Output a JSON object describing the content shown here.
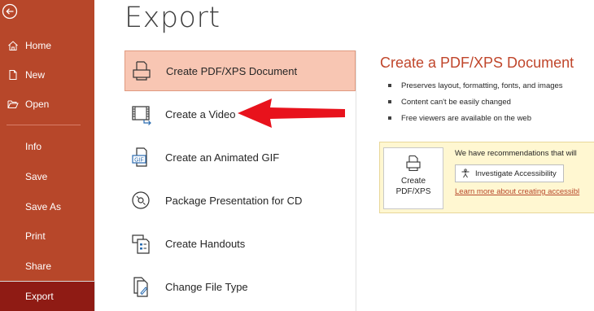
{
  "sidebar": {
    "items": [
      {
        "label": "Home",
        "icon": "home-icon"
      },
      {
        "label": "New",
        "icon": "new-document-icon"
      },
      {
        "label": "Open",
        "icon": "folder-open-icon"
      },
      {
        "label": "Info"
      },
      {
        "label": "Save"
      },
      {
        "label": "Save As"
      },
      {
        "label": "Print"
      },
      {
        "label": "Share"
      },
      {
        "label": "Export",
        "active": true
      }
    ]
  },
  "main": {
    "title": "Export",
    "options": [
      {
        "label": "Create PDF/XPS Document",
        "icon": "pdf-document-icon",
        "selected": true
      },
      {
        "label": "Create a Video",
        "icon": "video-icon"
      },
      {
        "label": "Create an Animated GIF",
        "icon": "gif-icon"
      },
      {
        "label": "Package Presentation for CD",
        "icon": "cd-icon"
      },
      {
        "label": "Create Handouts",
        "icon": "handouts-icon"
      },
      {
        "label": "Change File Type",
        "icon": "change-file-type-icon"
      }
    ]
  },
  "detail": {
    "title": "Create a PDF/XPS Document",
    "bullets": [
      "Preserves layout, formatting, fonts, and images",
      "Content can't be easily changed",
      "Free viewers are available on the web"
    ],
    "recommendation_text": "We have recommendations that will",
    "investigate_label": "Investigate Accessibility",
    "learn_more_label": "Learn more about creating accessibl",
    "create_button_line1": "Create",
    "create_button_line2": "PDF/XPS"
  },
  "colors": {
    "sidebar_bg": "#b7472a",
    "sidebar_active": "#8f1b14",
    "selected_option_bg": "#f8c6b3",
    "accent_text": "#c0462b",
    "arrow": "#e8121c",
    "recommendation_bg": "#fff7d1"
  }
}
